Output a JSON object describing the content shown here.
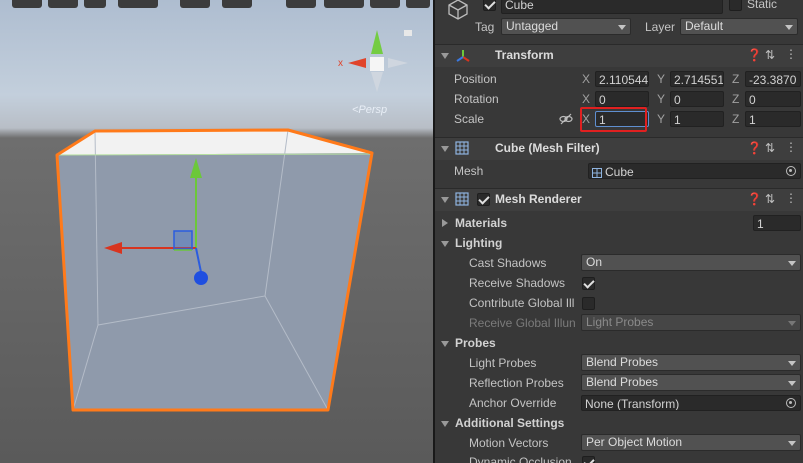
{
  "inspector": {
    "object_name": "Cube",
    "static_label": "Static",
    "tag_label": "Tag",
    "tag_value": "Untagged",
    "layer_label": "Layer",
    "layer_value": "Default"
  },
  "transform": {
    "title": "Transform",
    "position": {
      "label": "Position",
      "x": "2.110544",
      "y": "2.714551",
      "z": "-23.3870"
    },
    "rotation": {
      "label": "Rotation",
      "x": "0",
      "y": "0",
      "z": "0"
    },
    "scale": {
      "label": "Scale",
      "x": "1",
      "y": "1",
      "z": "1"
    },
    "axis_x": "X",
    "axis_y": "Y",
    "axis_z": "Z"
  },
  "mesh_filter": {
    "title": "Cube (Mesh Filter)",
    "mesh_label": "Mesh",
    "mesh_value": "Cube"
  },
  "mesh_renderer": {
    "title": "Mesh Renderer",
    "materials_label": "Materials",
    "materials_count": "1",
    "lighting_label": "Lighting",
    "cast_shadows_label": "Cast Shadows",
    "cast_shadows_value": "On",
    "receive_shadows_label": "Receive Shadows",
    "contribute_gi_label": "Contribute Global Ill",
    "receive_gi_label": "Receive Global Illun",
    "receive_gi_value": "Light Probes",
    "probes_label": "Probes",
    "light_probes_label": "Light Probes",
    "light_probes_value": "Blend Probes",
    "reflection_probes_label": "Reflection Probes",
    "reflection_probes_value": "Blend Probes",
    "anchor_override_label": "Anchor Override",
    "anchor_override_value": "None (Transform)",
    "additional_settings_label": "Additional Settings",
    "motion_vectors_label": "Motion Vectors",
    "motion_vectors_value": "Per Object Motion",
    "dynamic_occlusion_label": "Dynamic Occlusion"
  },
  "scene": {
    "persp_label": "<Persp",
    "gizmo_x_label": "x"
  },
  "colors": {
    "selection_outline": "#ff7a1a",
    "axis_x": "#d8341f",
    "axis_y": "#6cc83a",
    "axis_z": "#2a5ce0",
    "highlight_box": "#e02020"
  }
}
